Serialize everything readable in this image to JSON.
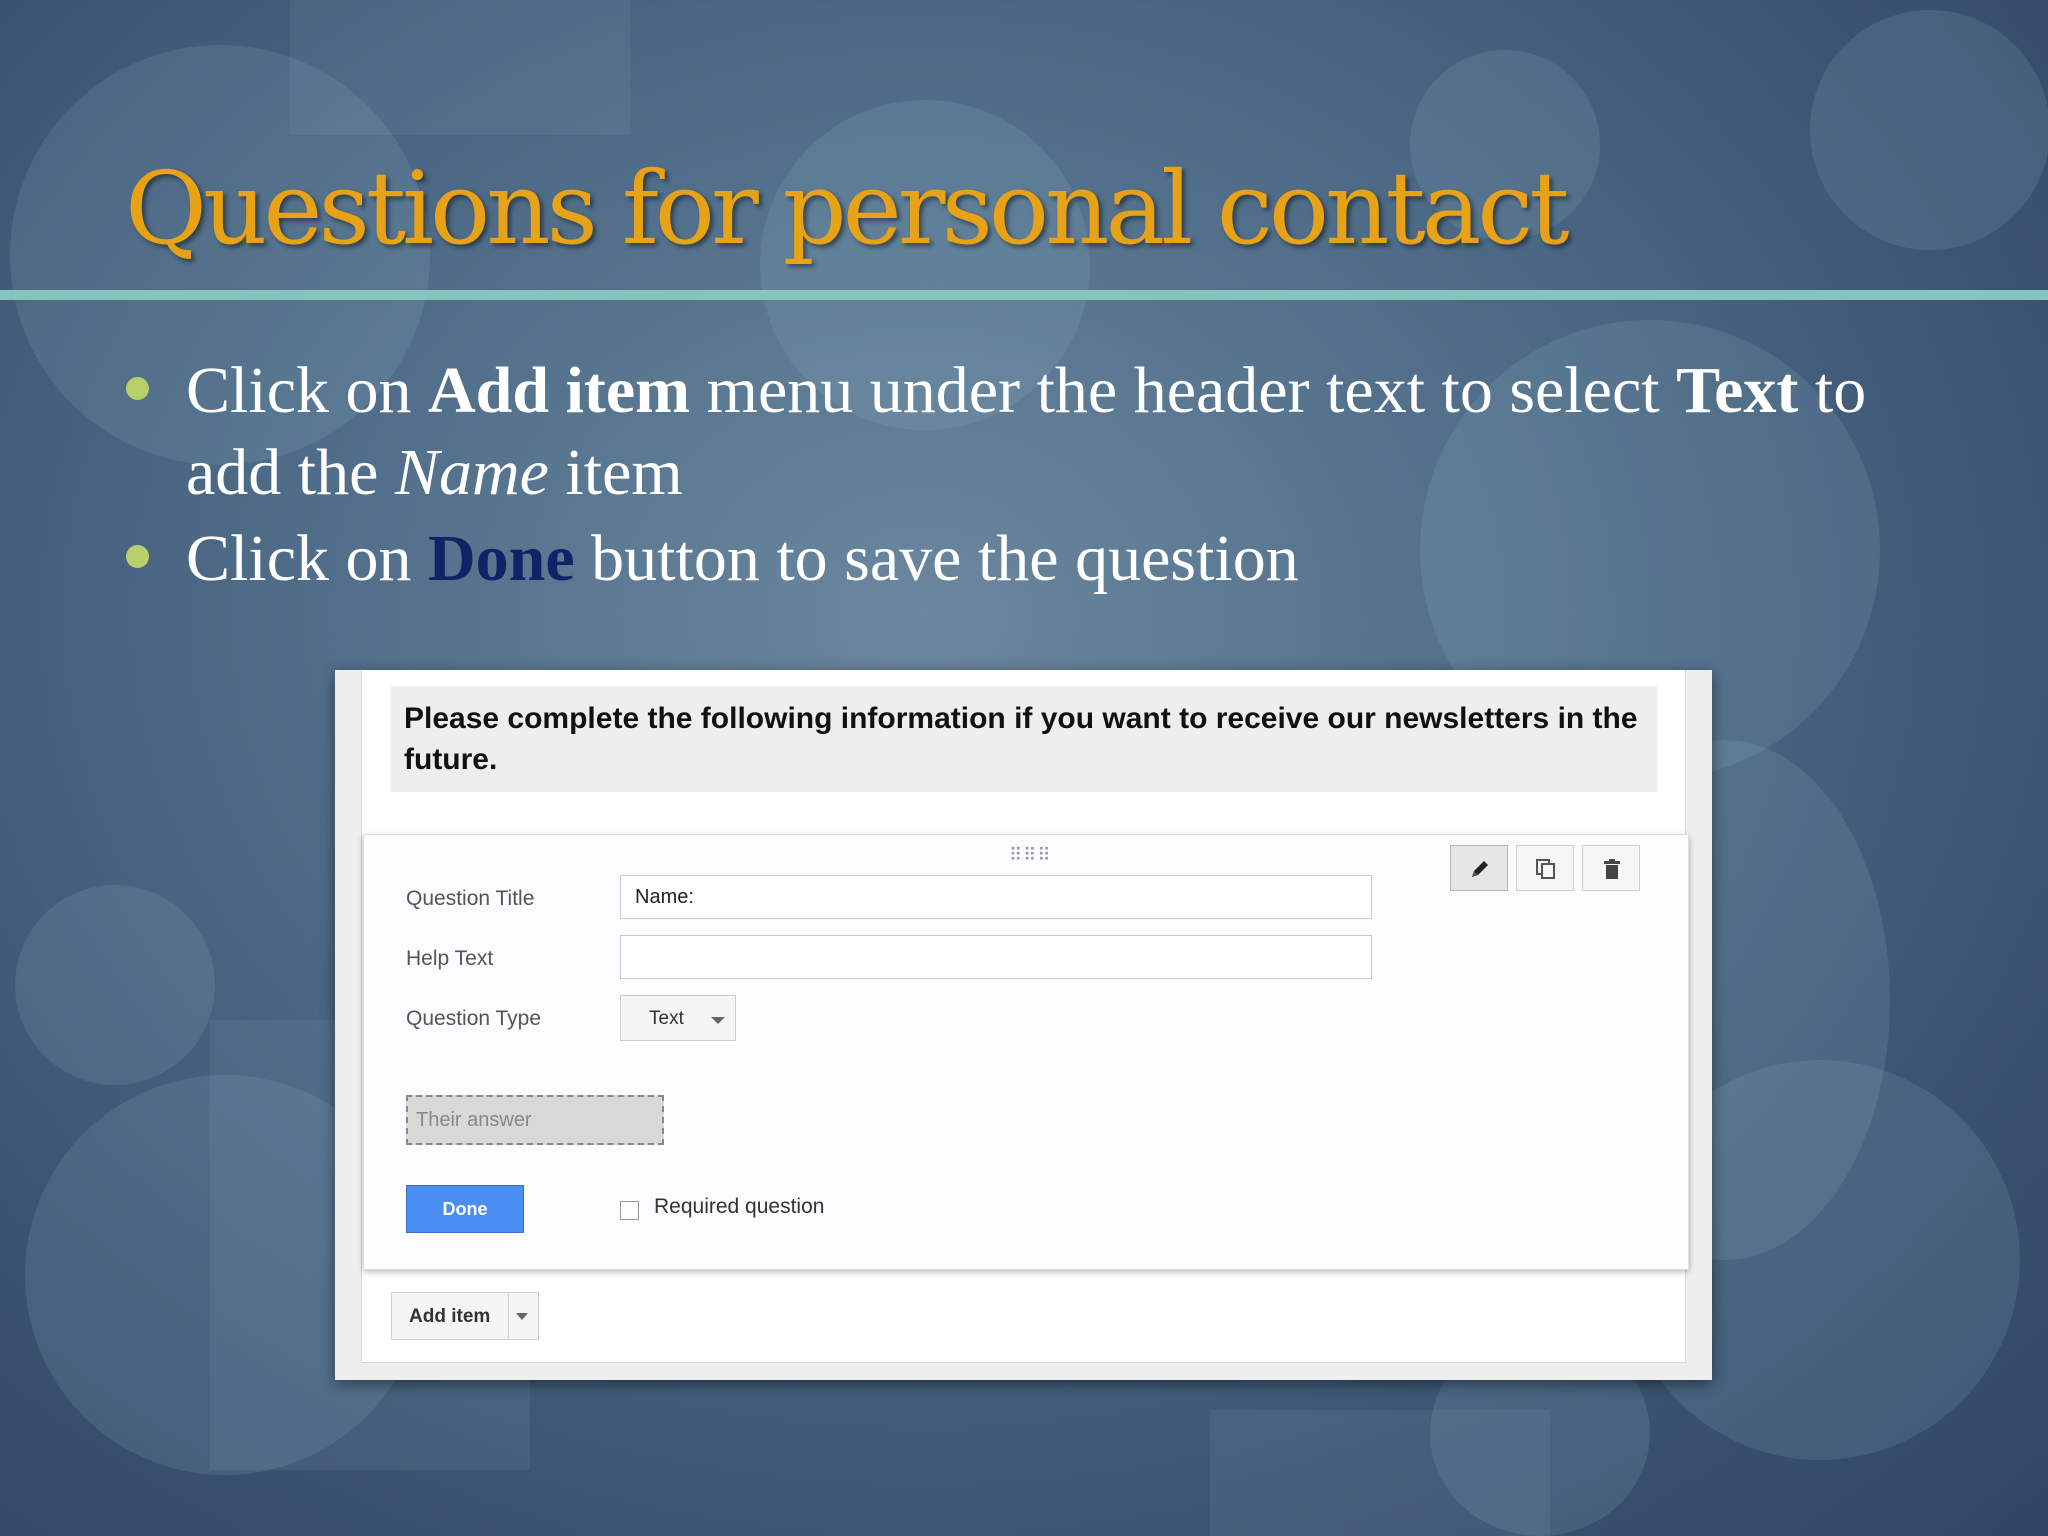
{
  "slide": {
    "title": "Questions for personal contact",
    "bullets": [
      {
        "pre": "Click on ",
        "bold": "Add item",
        "mid": " menu under the header text to select ",
        "bold2": "Text",
        "mid2": " to add the ",
        "italic": "Name",
        "post": " item"
      },
      {
        "pre": "Click on ",
        "highlight": "Done",
        "post": " button to save the question"
      }
    ],
    "colors": {
      "title": "#e8a218",
      "rule": "#86c5bd",
      "bullet": "#b9cf6b",
      "done_highlight": "#0d2466"
    }
  },
  "form": {
    "header_text": "Please complete the following information if you want to receive our newsletters in the future.",
    "question_title_label": "Question Title",
    "question_title_value": "Name:",
    "help_text_label": "Help Text",
    "help_text_value": "",
    "question_type_label": "Question Type",
    "question_type_value": "Text",
    "answer_placeholder": "Their answer",
    "done_label": "Done",
    "required_label": "Required question",
    "required_checked": false,
    "add_item_label": "Add item",
    "toolbar": {
      "edit_icon": "pencil-icon",
      "duplicate_icon": "duplicate-icon",
      "delete_icon": "trash-icon"
    },
    "colors": {
      "done_button": "#4b8ef1"
    }
  }
}
